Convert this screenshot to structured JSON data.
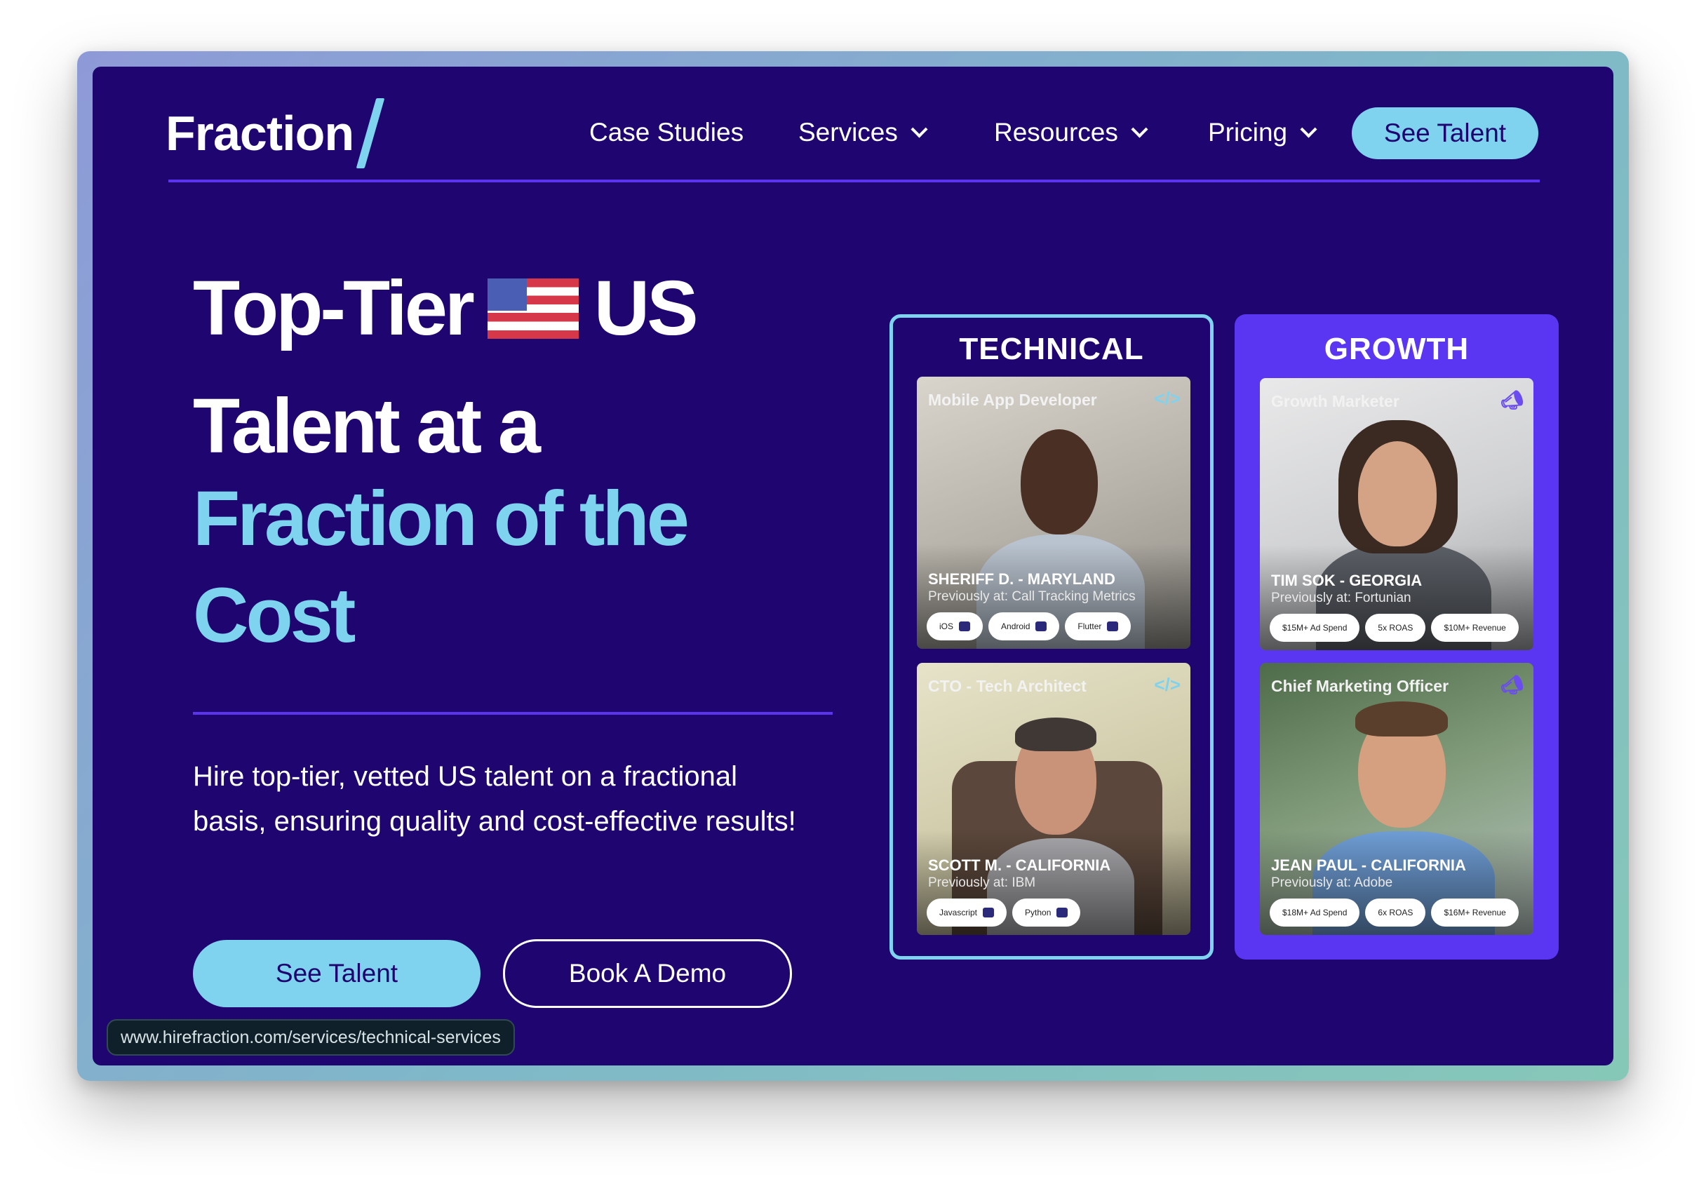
{
  "brand": {
    "name": "Fraction"
  },
  "nav": {
    "items": [
      {
        "label": "Case Studies",
        "has_dropdown": false
      },
      {
        "label": "Services",
        "has_dropdown": true
      },
      {
        "label": "Resources",
        "has_dropdown": true
      },
      {
        "label": "Pricing",
        "has_dropdown": true
      }
    ],
    "cta": "See Talent"
  },
  "hero": {
    "line1_a": "Top-Tier",
    "line1_b": "US",
    "line2": "Talent at a",
    "line3": "Fraction of the",
    "line4": "Cost",
    "subtitle": "Hire top-tier, vetted US talent on a fractional basis, ensuring quality and cost-effective results!",
    "primary_button": "See Talent",
    "secondary_button": "Book A Demo"
  },
  "status_bar": {
    "url": "www.hirefraction.com/services/technical-services"
  },
  "panels": {
    "technical": {
      "title": "TECHNICAL",
      "cards": [
        {
          "role": "Mobile App Developer",
          "icon": "code-icon",
          "name": "SHERIFF D. - MARYLAND",
          "previously": "Previously at: Call Tracking Metrics",
          "tags": [
            "iOS",
            "Android",
            "Flutter"
          ]
        },
        {
          "role": "CTO - Tech Architect",
          "icon": "code-icon",
          "name": "SCOTT M. - CALIFORNIA",
          "previously": "Previously at: IBM",
          "tags": [
            "Javascript",
            "Python"
          ]
        }
      ]
    },
    "growth": {
      "title": "GROWTH",
      "cards": [
        {
          "role": "Growth Marketer",
          "icon": "megaphone-icon",
          "name": "TIM SOK - GEORGIA",
          "previously": "Previously at: Fortunian",
          "tags": [
            "$15M+ Ad Spend",
            "5x ROAS",
            "$10M+ Revenue"
          ]
        },
        {
          "role": "Chief Marketing Officer",
          "icon": "megaphone-icon",
          "name": "JEAN PAUL - CALIFORNIA",
          "previously": "Previously at: Adobe",
          "tags": [
            "$18M+ Ad Spend",
            "6x ROAS",
            "$16M+ Revenue"
          ]
        }
      ]
    }
  },
  "colors": {
    "background": "#1f0570",
    "accent": "#7fd3ee",
    "purple": "#5a35f2",
    "rule": "#5b35ee"
  }
}
